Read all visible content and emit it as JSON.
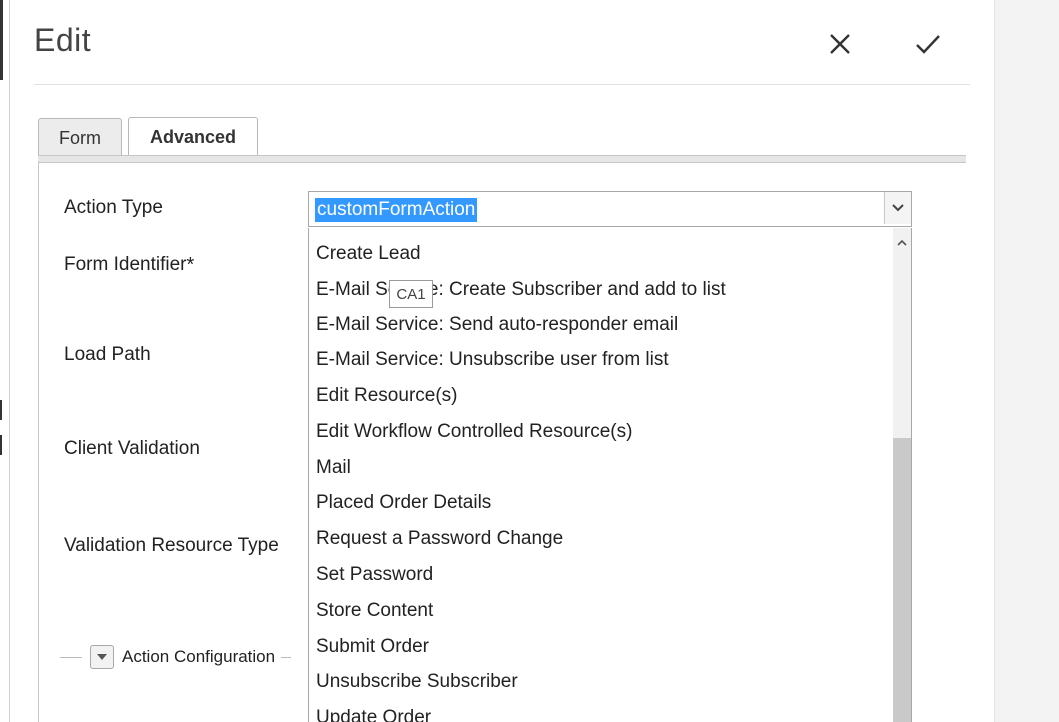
{
  "dialog": {
    "title": "Edit",
    "close_icon": "close-icon",
    "confirm_icon": "checkmark-icon"
  },
  "tabs": [
    {
      "label": "Form",
      "active": false
    },
    {
      "label": "Advanced",
      "active": true
    }
  ],
  "fields": {
    "action_type": "Action Type",
    "form_identifier": "Form Identifier",
    "required_marker": "*",
    "load_path": "Load Path",
    "client_validation": "Client Validation",
    "validation_resource_type": "Validation Resource Type"
  },
  "action_select": {
    "value": "customFormAction"
  },
  "dropdown_options": [
    "Create Lead",
    "E-Mail Service: Create Subscriber and add to list",
    "E-Mail Service: Send auto-responder email",
    "E-Mail Service: Unsubscribe user from list",
    "Edit Resource(s)",
    "Edit Workflow Controlled Resource(s)",
    "Mail",
    "Placed Order Details",
    "Request a Password Change",
    "Set Password",
    "Store Content",
    "Submit Order",
    "Unsubscribe Subscriber",
    "Update Order"
  ],
  "tooltip": "CA1",
  "section": {
    "label": "Action Configuration"
  },
  "colors": {
    "selection": "#3399ff",
    "scroll_thumb": "#c9c9c9"
  }
}
